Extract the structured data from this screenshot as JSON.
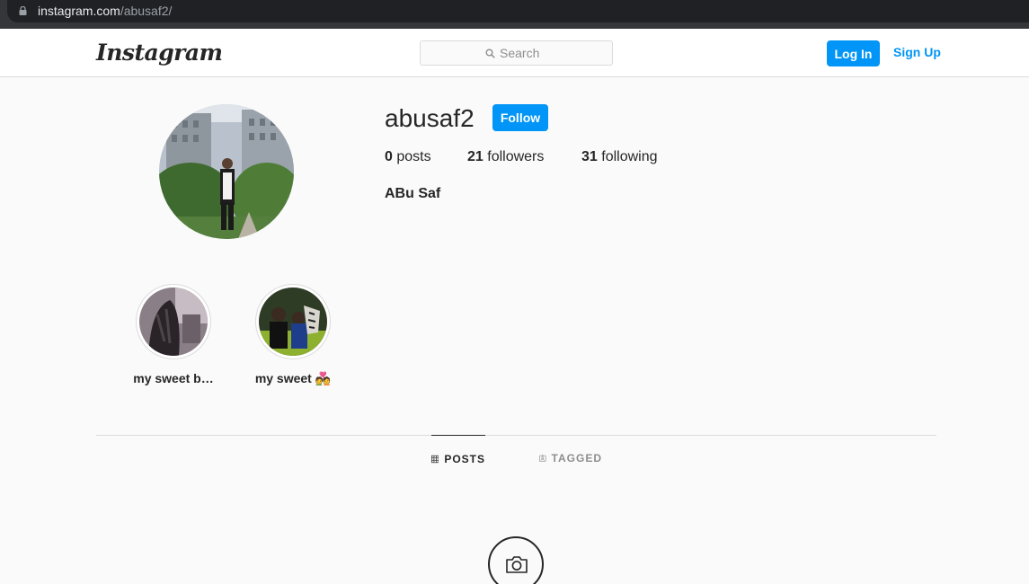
{
  "browser": {
    "url_host": "instagram.com",
    "url_path": "/abusaf2/"
  },
  "nav": {
    "logo": "Instagram",
    "search_placeholder": "Search",
    "login_label": "Log In",
    "signup_label": "Sign Up",
    "accent": "#0095f6"
  },
  "profile": {
    "username": "abusaf2",
    "follow_label": "Follow",
    "posts_count": "0",
    "posts_label": "posts",
    "followers_count": "21",
    "followers_label": "followers",
    "following_count": "31",
    "following_label": "following",
    "full_name": "ABu Saf"
  },
  "highlights": [
    {
      "label": "my sweet b…"
    },
    {
      "label": "my sweet 💑"
    }
  ],
  "tabs": [
    {
      "label": "POSTS",
      "icon": "grid-icon",
      "active": true
    },
    {
      "label": "TAGGED",
      "icon": "tag-icon",
      "active": false
    }
  ],
  "empty_state": {
    "icon": "camera-icon"
  }
}
